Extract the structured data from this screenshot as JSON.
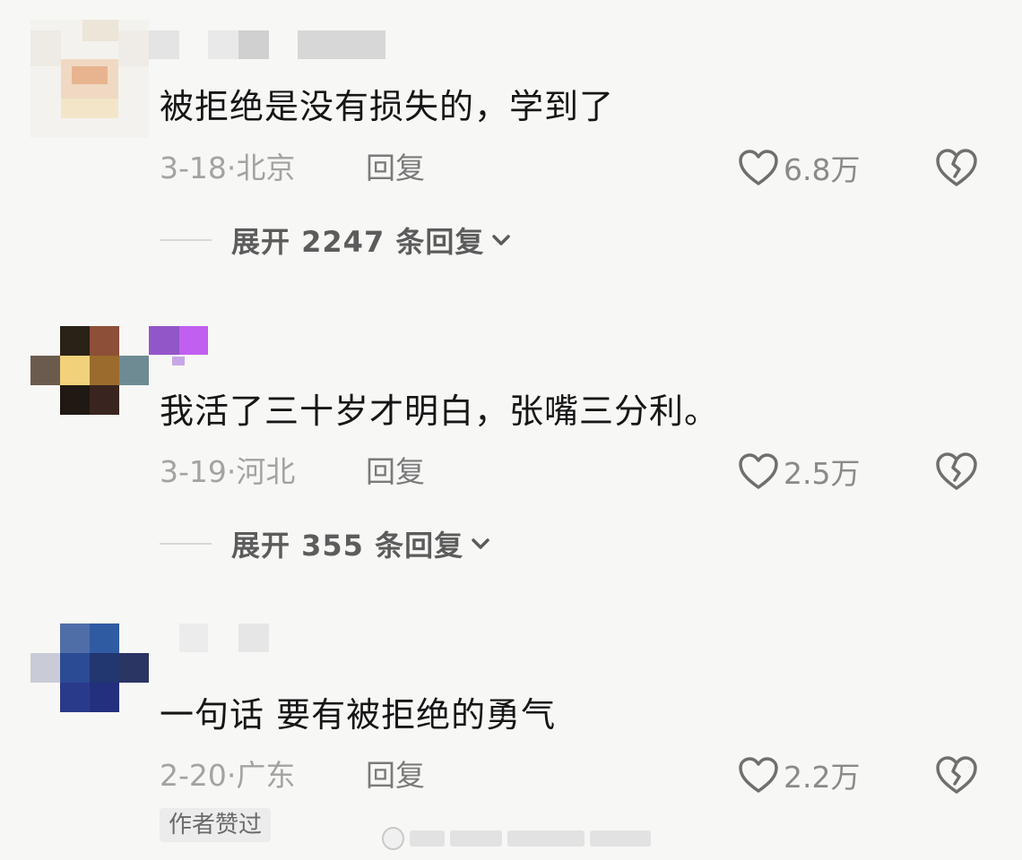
{
  "comments": [
    {
      "text": "被拒绝是没有损失的，学到了",
      "date": "3-18·",
      "location": "北京",
      "reply_label": "回复",
      "likes": "6.8万",
      "expand_label": "展开 2247 条回复"
    },
    {
      "text": "我活了三十岁才明白，张嘴三分利。",
      "date": "3-19·",
      "location": "河北",
      "reply_label": "回复",
      "likes": "2.5万",
      "expand_label": "展开 355 条回复"
    },
    {
      "text": "一句话 要有被拒绝的勇气",
      "date": "2-20·",
      "location": "广东",
      "reply_label": "回复",
      "likes": "2.2万",
      "author_badge": "作者赞过"
    }
  ],
  "icons": {
    "like": "heart-outline-icon",
    "dislike": "broken-heart-icon",
    "expand": "chevron-down-icon"
  },
  "colors": {
    "background": "#f7f7f5",
    "text": "#161616",
    "meta": "#a3a3a3",
    "icon": "#6f6f6f"
  }
}
